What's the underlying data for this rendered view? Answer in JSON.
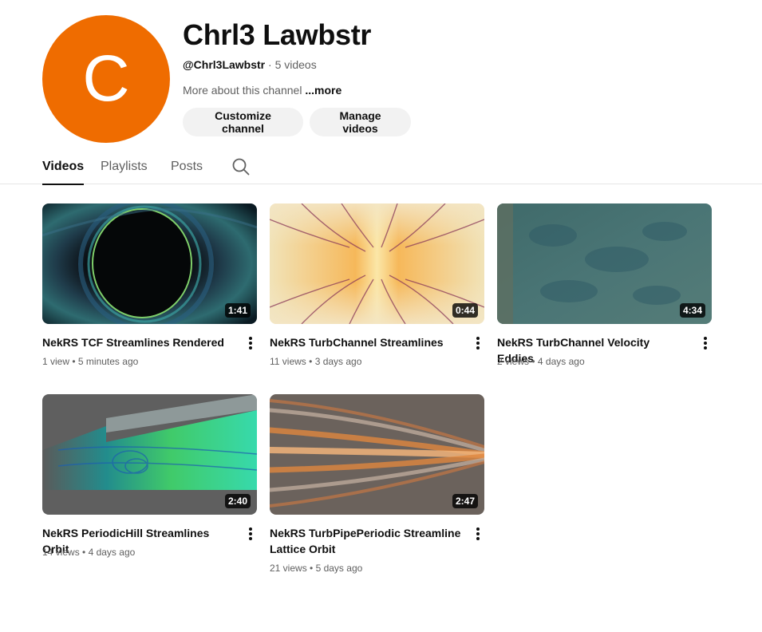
{
  "channel": {
    "avatar_letter": "C",
    "avatar_color": "#ef6c00",
    "name": "Chrl3 Lawbstr",
    "handle": "@Chrl3Lawbstr",
    "separator": "·",
    "video_count": "5 videos",
    "about": "More about this channel",
    "more_label": "...more"
  },
  "buttons": {
    "customize": "Customize channel",
    "manage": "Manage videos"
  },
  "tabs": [
    {
      "label": "Videos",
      "active": true
    },
    {
      "label": "Playlists",
      "active": false
    },
    {
      "label": "Posts",
      "active": false
    }
  ],
  "search_icon": "search-icon",
  "videos": [
    {
      "title": "NekRS TCF Streamlines Rendered",
      "duration": "1:41",
      "views": "1 view",
      "age": "5 minutes ago"
    },
    {
      "title": "NekRS TurbChannel Streamlines",
      "duration": "0:44",
      "views": "11 views",
      "age": "3 days ago"
    },
    {
      "title": "NekRS TurbChannel Velocity Eddies",
      "duration": "4:34",
      "views": "2 views",
      "age": "4 days ago"
    },
    {
      "title": "NekRS PeriodicHill Streamlines Orbit",
      "duration": "2:40",
      "views": "14 views",
      "age": "4 days ago"
    },
    {
      "title": "NekRS TurbPipePeriodic Streamline Lattice Orbit",
      "duration": "2:47",
      "views": "21 views",
      "age": "5 days ago"
    }
  ],
  "stats_separator": "•",
  "menu_icon": "more-vert-icon"
}
